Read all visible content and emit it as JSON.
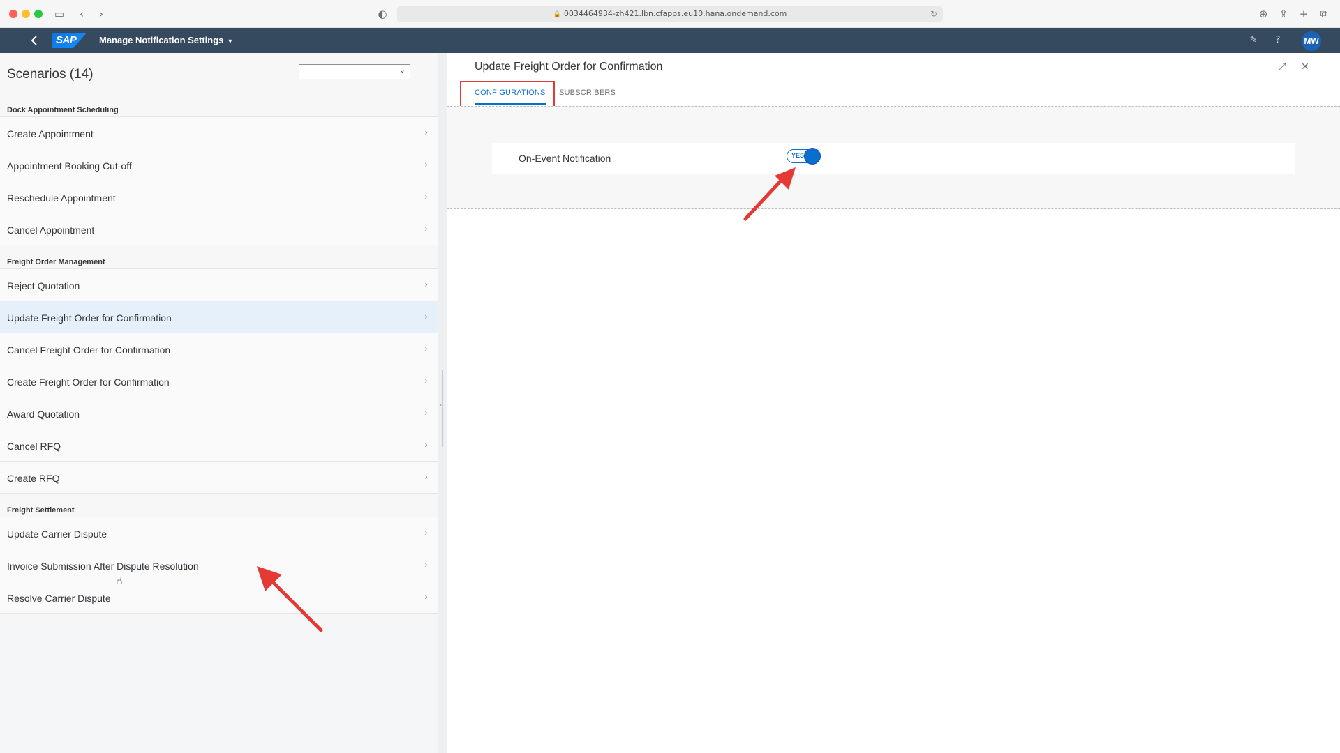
{
  "browser": {
    "url": "0034464934-zh421.lbn.cfapps.eu10.hana.ondemand.com"
  },
  "shell": {
    "logo": "SAP",
    "app_title": "Manage Notification Settings",
    "avatar_initials": "MW"
  },
  "master": {
    "title": "Scenarios (14)",
    "groups": [
      {
        "name": "Dock Appointment Scheduling",
        "items": [
          "Create Appointment",
          "Appointment Booking Cut-off",
          "Reschedule Appointment",
          "Cancel Appointment"
        ]
      },
      {
        "name": "Freight Order Management",
        "items": [
          "Reject Quotation",
          "Update Freight Order for Confirmation",
          "Cancel Freight Order for Confirmation",
          "Create Freight Order for Confirmation",
          "Award Quotation",
          "Cancel RFQ",
          "Create RFQ"
        ]
      },
      {
        "name": "Freight Settlement",
        "items": [
          "Update Carrier Dispute",
          "Invoice Submission After Dispute Resolution",
          "Resolve Carrier Dispute"
        ]
      }
    ],
    "selected_item": "Update Freight Order for Confirmation"
  },
  "detail": {
    "title": "Update Freight Order for Confirmation",
    "tabs": [
      {
        "label": "CONFIGURATIONS",
        "active": true
      },
      {
        "label": "SUBSCRIBERS",
        "active": false
      }
    ],
    "config": {
      "label": "On-Event Notification",
      "toggle_text": "YES",
      "toggle_on": true
    }
  },
  "colors": {
    "shell_bg": "#354a5f",
    "accent": "#0a6ed1",
    "annotation": "#e53935"
  },
  "icons": [
    "sidebar-icon",
    "back-icon",
    "forward-icon",
    "shield-icon",
    "lock-icon",
    "reload-icon",
    "download-icon",
    "share-icon",
    "plus-icon",
    "tabs-icon",
    "shell-back-icon",
    "notification-icon",
    "help-icon",
    "chevron-down-icon",
    "chevron-right-icon",
    "expand-icon",
    "close-icon",
    "hand-cursor-icon"
  ]
}
